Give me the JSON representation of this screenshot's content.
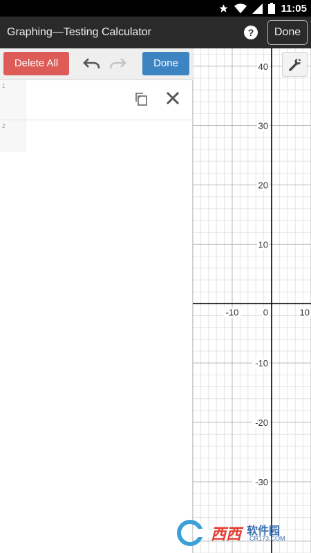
{
  "status_bar": {
    "time": "11:05",
    "icons": [
      "star-icon",
      "wifi-icon",
      "signal-icon",
      "battery-icon"
    ]
  },
  "app_bar": {
    "title": "Graphing—Testing Calculator",
    "help_label": "?",
    "done_label": "Done"
  },
  "toolbar": {
    "delete_all_label": "Delete All",
    "done_label": "Done",
    "undo_icon": "undo-icon",
    "redo_icon": "redo-icon"
  },
  "expressions": [
    {
      "number": "1",
      "value": "",
      "actions": [
        "copy-icon",
        "close-icon"
      ]
    },
    {
      "number": "2",
      "value": ""
    }
  ],
  "graph": {
    "settings_icon": "wrench-icon",
    "x_range": [
      -20,
      10
    ],
    "y_range": [
      -42,
      43
    ],
    "x_tick_labels": [
      "-10",
      "0",
      "10"
    ],
    "y_tick_labels": [
      "40",
      "30",
      "20",
      "10",
      "-10",
      "-20",
      "-30"
    ],
    "minor_step": 2,
    "major_step": 10
  },
  "colors": {
    "delete": "#dd5c57",
    "done": "#3d84c3",
    "app_bar": "#2a2a2a",
    "axis": "#000000",
    "major_grid": "#b8b8b8",
    "minor_grid": "#e4e4e4"
  },
  "watermark": {
    "brand": "西西",
    "text": "软件园",
    "site": "CR173.COM"
  }
}
